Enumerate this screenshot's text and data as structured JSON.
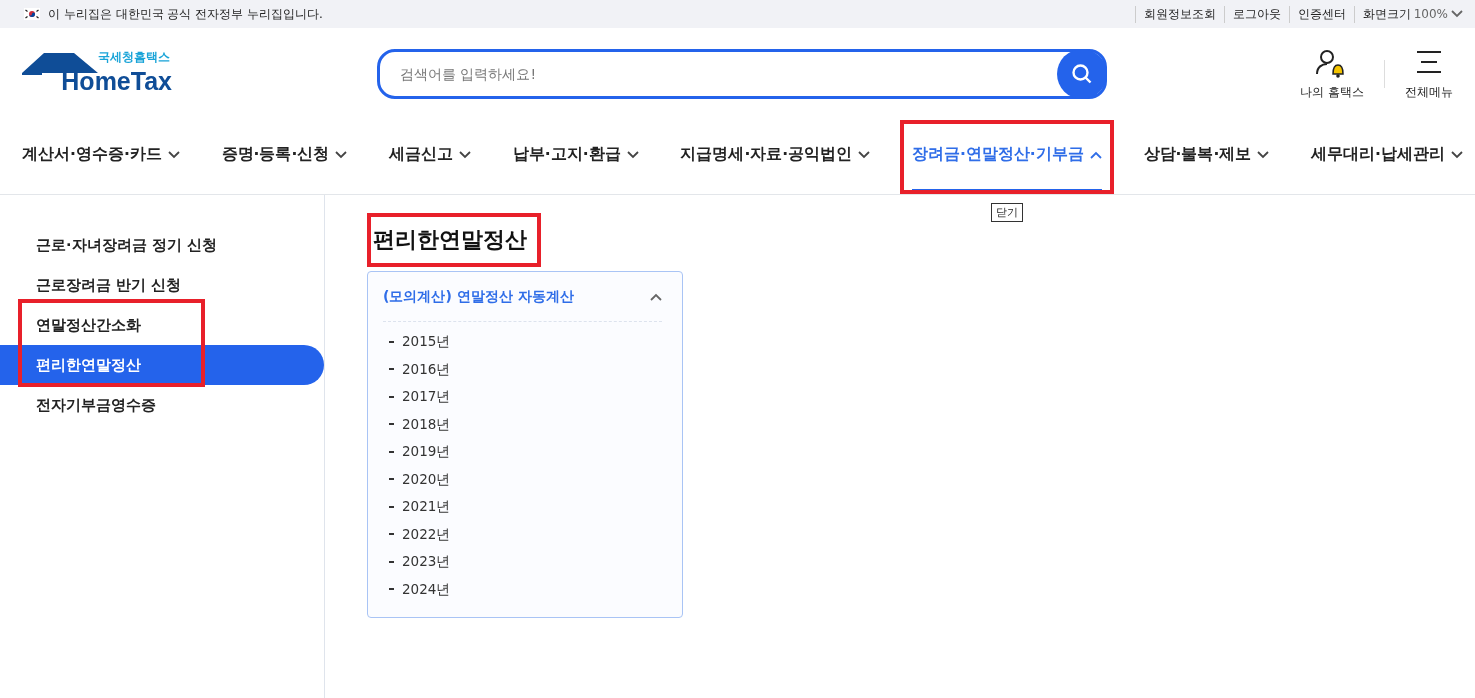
{
  "top_bar": {
    "notice": "이 누리집은 대한민국 공식 전자정부 누리집입니다.",
    "links": [
      "회원정보조회",
      "로그아웃",
      "인증센터"
    ],
    "zoom_label": "화면크기",
    "zoom_value": "100%"
  },
  "header": {
    "logo": {
      "subtitle": "국세청홈택스",
      "title": "HomeTax"
    },
    "search": {
      "placeholder": "검색어를 입력하세요!"
    },
    "my_hometax": "나의 홈택스",
    "all_menu": "전체메뉴"
  },
  "nav": [
    {
      "label": "계산서·영수증·카드",
      "selected": false,
      "highlighted": false
    },
    {
      "label": "증명·등록·신청",
      "selected": false,
      "highlighted": false
    },
    {
      "label": "세금신고",
      "selected": false,
      "highlighted": false
    },
    {
      "label": "납부·고지·환급",
      "selected": false,
      "highlighted": false
    },
    {
      "label": "지급명세·자료·공익법인",
      "selected": false,
      "highlighted": false
    },
    {
      "label": "장려금·연말정산·기부금",
      "selected": true,
      "highlighted": true,
      "tooltip": "닫기"
    },
    {
      "label": "상담·불복·제보",
      "selected": false,
      "highlighted": false
    },
    {
      "label": "세무대리·납세관리",
      "selected": false,
      "highlighted": false
    }
  ],
  "sidebar": {
    "items": [
      {
        "label": "근로·자녀장려금 정기 신청",
        "selected": false,
        "highlighted": false
      },
      {
        "label": "근로장려금 반기 신청",
        "selected": false,
        "highlighted": false
      },
      {
        "label": "연말정산간소화",
        "selected": false,
        "highlighted": true
      },
      {
        "label": "편리한연말정산",
        "selected": true,
        "highlighted": true
      },
      {
        "label": "전자기부금영수증",
        "selected": false,
        "highlighted": false
      }
    ]
  },
  "content": {
    "title": "편리한연말정산",
    "title_highlighted": true,
    "panel": {
      "title": "(모의계산) 연말정산 자동계산",
      "expanded": true,
      "items": [
        "2015년",
        "2016년",
        "2017년",
        "2018년",
        "2019년",
        "2020년",
        "2021년",
        "2022년",
        "2023년",
        "2024년"
      ]
    }
  }
}
